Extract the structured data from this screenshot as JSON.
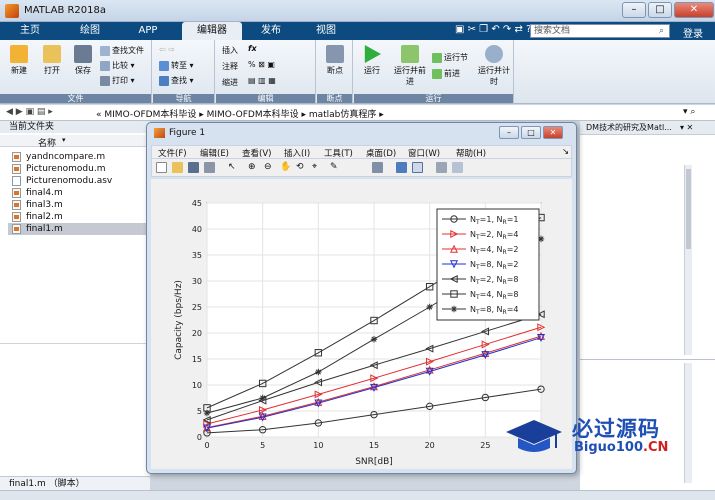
{
  "window": {
    "title": "MATLAB R2018a",
    "minimize": "–",
    "maximize": "□",
    "close": "✕"
  },
  "tabs": [
    {
      "label": "主页"
    },
    {
      "label": "绘图"
    },
    {
      "label": "APP"
    },
    {
      "label": "编辑器"
    },
    {
      "label": "发布"
    },
    {
      "label": "视图"
    }
  ],
  "search": {
    "placeholder": "搜索文档",
    "login": "登录"
  },
  "ribbon": {
    "file": {
      "label": "文件",
      "new": "新建",
      "open": "打开",
      "save": "保存",
      "find_files": "查找文件",
      "compare": "比较",
      "print": "打印"
    },
    "nav": {
      "label": "导航",
      "goto": "转至",
      "find": "查找"
    },
    "edit": {
      "label": "编辑",
      "insert": "插入",
      "comment": "注释",
      "indent": "缩进",
      "fx": "fx"
    },
    "breakpoints": {
      "label": "断点",
      "title": "断点"
    },
    "run": {
      "label": "运行",
      "run": "运行",
      "run_advance": "运行并前进",
      "run_section": "运行节",
      "advance": "前进",
      "run_time": "运行并计时"
    }
  },
  "path": {
    "sep": "«",
    "parts": [
      "MIMO-OFDM本科毕设",
      "MIMO-OFDM本科毕设",
      "matlab仿真程序"
    ]
  },
  "panel": {
    "title": "当前文件夹",
    "column": "名称",
    "files": [
      {
        "name": "yandncompare.m"
      },
      {
        "name": "Picturenomodu.m"
      },
      {
        "name": "Picturenomodu.asv"
      },
      {
        "name": "final4.m"
      },
      {
        "name": "final3.m"
      },
      {
        "name": "final2.m"
      },
      {
        "name": "final1.m"
      }
    ],
    "detail": "final1.m （脚本）"
  },
  "rightpane": {
    "title": "DM技术的研究及Matl..."
  },
  "figure": {
    "title": "Figure 1",
    "menu": [
      "文件(F)",
      "编辑(E)",
      "查看(V)",
      "插入(I)",
      "工具(T)",
      "桌面(D)",
      "窗口(W)",
      "帮助(H)"
    ]
  },
  "chart_data": {
    "type": "line",
    "x": [
      0,
      5,
      10,
      15,
      20,
      25,
      30
    ],
    "xlabel": "SNR[dB]",
    "ylabel": "Capacity (bps/Hz)",
    "xlim": [
      0,
      30
    ],
    "ylim": [
      0,
      45
    ],
    "xticks": [
      0,
      5,
      10,
      15,
      20,
      25
    ],
    "yticks": [
      0,
      5,
      10,
      15,
      20,
      25,
      30,
      35,
      40,
      45
    ],
    "grid": true,
    "legend_position": "top-right",
    "series": [
      {
        "name": "NT=1, NR=1",
        "nt": "1",
        "nr": "1",
        "color": "#333333",
        "marker": "circle",
        "values": [
          0.8,
          1.4,
          2.7,
          4.3,
          5.9,
          7.6,
          9.2
        ]
      },
      {
        "name": "NT=2, NR=4",
        "nt": "2",
        "nr": "4",
        "color": "#e03030",
        "marker": "triangle-right",
        "values": [
          2.5,
          5.2,
          8.2,
          11.3,
          14.5,
          17.8,
          21.1
        ]
      },
      {
        "name": "NT=4, NR=2",
        "nt": "4",
        "nr": "2",
        "color": "#e03030",
        "marker": "triangle-up",
        "values": [
          1.8,
          4.0,
          6.7,
          9.7,
          12.9,
          16.1,
          19.4
        ]
      },
      {
        "name": "NT=8, NR=2",
        "nt": "8",
        "nr": "2",
        "color": "#2030d0",
        "marker": "triangle-down",
        "values": [
          1.7,
          3.8,
          6.5,
          9.5,
          12.6,
          15.8,
          19.1
        ]
      },
      {
        "name": "NT=2, NR=8",
        "nt": "2",
        "nr": "8",
        "color": "#333333",
        "marker": "triangle-left",
        "values": [
          3.3,
          7.0,
          10.5,
          13.8,
          17.0,
          20.3,
          23.6
        ]
      },
      {
        "name": "NT=4, NR=8",
        "nt": "4",
        "nr": "8",
        "color": "#333333",
        "marker": "square",
        "values": [
          5.6,
          10.3,
          16.2,
          22.4,
          28.9,
          35.5,
          42.2
        ]
      },
      {
        "name": "NT=8, NR=4",
        "nt": "8",
        "nr": "4",
        "color": "#333333",
        "marker": "star",
        "values": [
          4.6,
          7.5,
          12.5,
          18.8,
          25.0,
          31.5,
          38.1
        ]
      }
    ]
  },
  "watermark": {
    "text": "必过源码",
    "site": "Biguo100",
    "cn": ".CN"
  },
  "colors": {
    "tab_bar": "#0c4a7f",
    "ribbon": "#dde5ee",
    "selection": "#c5c9d1"
  }
}
